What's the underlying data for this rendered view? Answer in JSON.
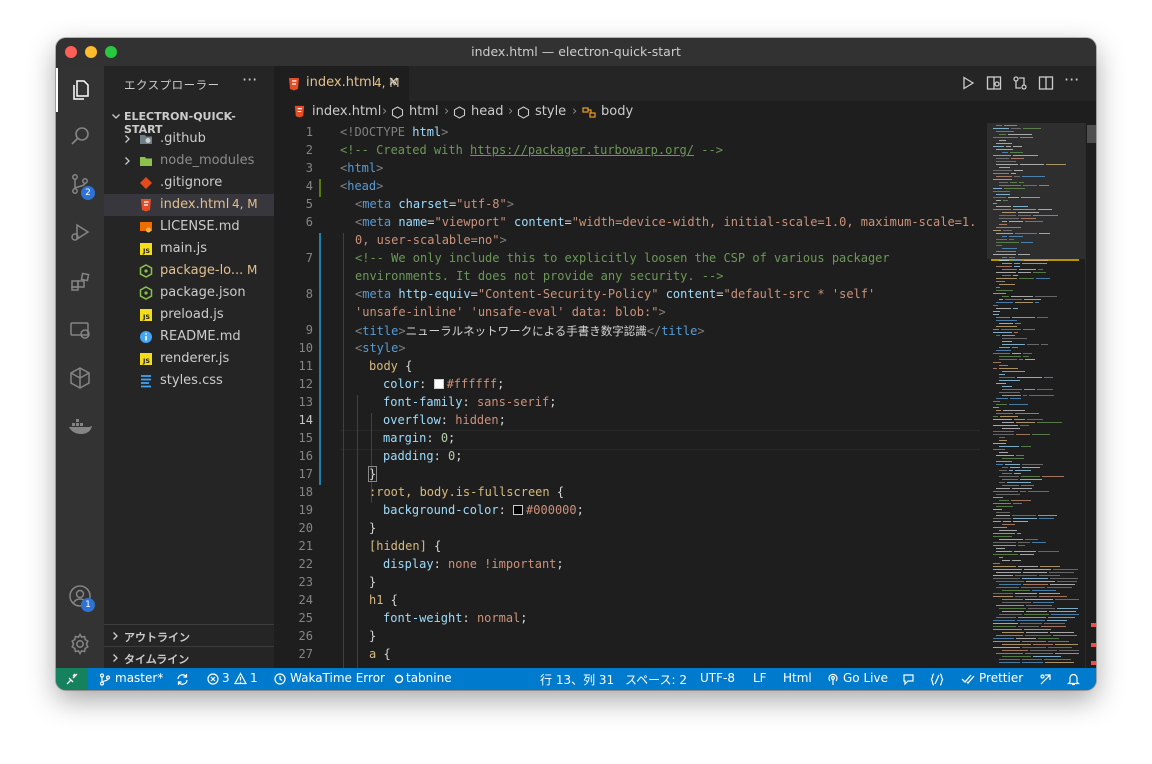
{
  "window": {
    "title": "index.html — electron-quick-start"
  },
  "activity_bar": {
    "scm_badge": "2",
    "accounts_badge": "1"
  },
  "sidebar": {
    "title": "エクスプローラー",
    "more": "···",
    "section": "ELECTRON-QUICK-START",
    "files": [
      {
        "name": ".github",
        "status": "",
        "color": "#cccccc"
      },
      {
        "name": "node_modules",
        "status": "",
        "color": "#8c8c8c"
      },
      {
        "name": ".gitignore",
        "status": "",
        "color": "#cccccc"
      },
      {
        "name": "index.html",
        "status": "4, M",
        "color": "#e2c08d"
      },
      {
        "name": "LICENSE.md",
        "status": "",
        "color": "#cccccc"
      },
      {
        "name": "main.js",
        "status": "",
        "color": "#cccccc"
      },
      {
        "name": "package-lo...",
        "status": "M",
        "color": "#e2c08d"
      },
      {
        "name": "package.json",
        "status": "",
        "color": "#cccccc"
      },
      {
        "name": "preload.js",
        "status": "",
        "color": "#cccccc"
      },
      {
        "name": "README.md",
        "status": "",
        "color": "#cccccc"
      },
      {
        "name": "renderer.js",
        "status": "",
        "color": "#cccccc"
      },
      {
        "name": "styles.css",
        "status": "",
        "color": "#cccccc"
      }
    ],
    "outline": "アウトライン",
    "timeline": "タイムライン"
  },
  "editor": {
    "tab": {
      "label": "index.html",
      "status": "4, M",
      "close": "✕"
    },
    "breadcrumb": [
      "index.html",
      "html",
      "head",
      "style",
      "body"
    ],
    "line_numbers": [
      "1",
      "2",
      "3",
      "4",
      "5",
      "6",
      "",
      "7",
      "",
      "8",
      "",
      "9",
      "10",
      "11",
      "12",
      "13",
      "14",
      "15",
      "16",
      "17",
      "18",
      "19",
      "20",
      "21",
      "22",
      "23",
      "24",
      "25",
      "26",
      "27"
    ],
    "code": {
      "l1": [
        "<!DOCTYPE",
        " html",
        ">"
      ],
      "l2": [
        "<!-- Created with ",
        "https://packager.turbowarp.org/",
        " -->"
      ],
      "l3": [
        "<",
        "html",
        ">"
      ],
      "l4": [
        "<",
        "head",
        ">"
      ],
      "l5": [
        "<",
        "meta",
        " charset",
        "=",
        "\"utf-8\"",
        ">"
      ],
      "l6": [
        "<",
        "meta",
        " name",
        "=",
        "\"viewport\"",
        " content",
        "=",
        "\"width=device-width, initial-scale=1.0, maximum-scale=1."
      ],
      "l6b": [
        "0, user-scalable=no\"",
        ">"
      ],
      "l7": [
        "<!-- We only include this to explicitly loosen the CSP of various packager"
      ],
      "l7b": [
        "environments. It does not provide any security. -->"
      ],
      "l8": [
        "<",
        "meta",
        " http-equiv",
        "=",
        "\"Content-Security-Policy\"",
        " content",
        "=",
        "\"default-src * 'self'"
      ],
      "l8b": [
        "'unsafe-inline' 'unsafe-eval' data: blob:\"",
        ">"
      ],
      "l9": [
        "<",
        "title",
        ">",
        "ニューラルネットワークによる手書き数字認識",
        "</",
        "title",
        ">"
      ],
      "l10": [
        "<",
        "style",
        ">"
      ],
      "l11": [
        "body",
        " {"
      ],
      "l12": [
        "color",
        ": ",
        "#ffffff",
        ";"
      ],
      "l13": [
        "font-family",
        ": ",
        "sans-serif",
        ";"
      ],
      "l14": [
        "overflow",
        ": ",
        "hidden",
        ";"
      ],
      "l15": [
        "margin",
        ": ",
        "0",
        ";"
      ],
      "l16": [
        "padding",
        ": ",
        "0",
        ";"
      ],
      "l17": [
        "}"
      ],
      "l18": [
        ":root, body.is-fullscreen",
        " {"
      ],
      "l19": [
        "background-color",
        ": ",
        "#000000",
        ";"
      ],
      "l20": [
        "}"
      ],
      "l21": [
        "[hidden]",
        " {"
      ],
      "l22": [
        "display",
        ": ",
        "none !important",
        ";"
      ],
      "l23": [
        "}"
      ],
      "l24": [
        "h1",
        " {"
      ],
      "l25": [
        "font-weight",
        ": ",
        "normal",
        ";"
      ],
      "l26": [
        "}"
      ],
      "l27": [
        "a",
        " {"
      ]
    },
    "colors": {
      "swatch_white": "#ffffff",
      "swatch_black": "#000000"
    }
  },
  "statusbar": {
    "branch": "master*",
    "errors": "3",
    "warnings": "1",
    "wakatime": "WakaTime Error",
    "tabnine": "tabnine",
    "position": "行 13、列 31",
    "spaces": "スペース: 2",
    "encoding": "UTF-8",
    "eol": "LF",
    "language": "Html",
    "golive": "Go Live",
    "prettier": "Prettier"
  }
}
